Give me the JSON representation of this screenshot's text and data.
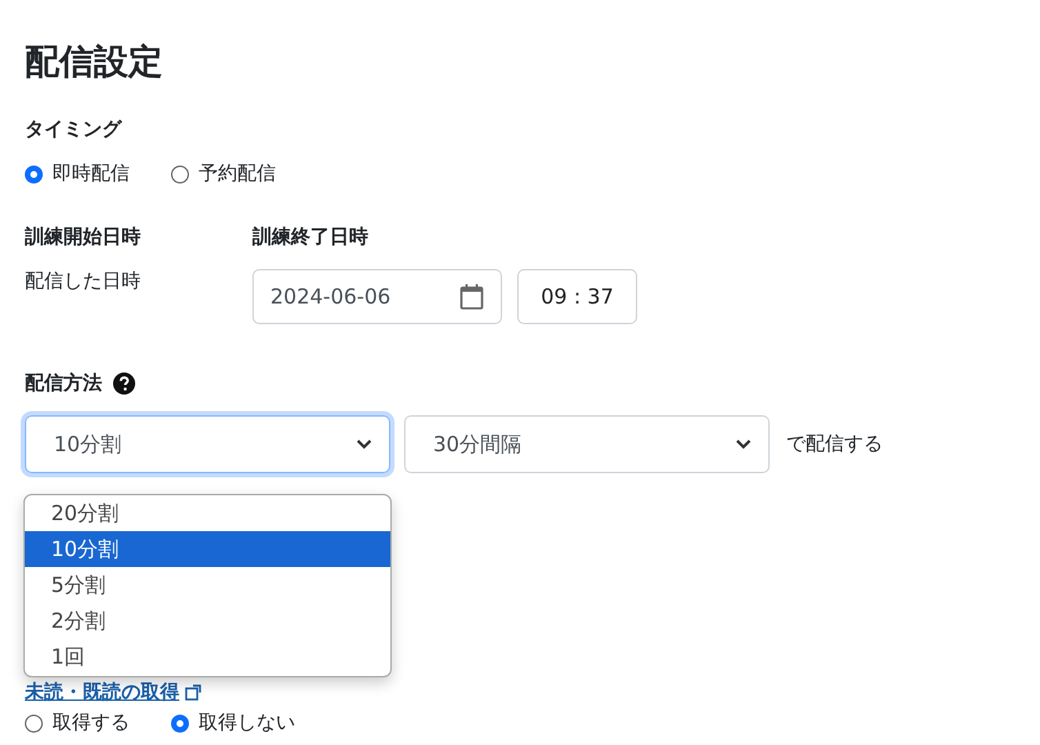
{
  "page_title": "配信設定",
  "timing": {
    "label": "タイミング",
    "options": [
      {
        "label": "即時配信",
        "selected": true
      },
      {
        "label": "予約配信",
        "selected": false
      }
    ]
  },
  "schedule": {
    "start": {
      "label": "訓練開始日時",
      "value": "配信した日時"
    },
    "end": {
      "label": "訓練終了日時",
      "date": "2024-06-06",
      "time": "09 : 37"
    }
  },
  "method": {
    "label": "配信方法",
    "split_select": {
      "value": "10分割",
      "open": true,
      "options": [
        {
          "label": "20分割",
          "selected": false
        },
        {
          "label": "10分割",
          "selected": true
        },
        {
          "label": "5分割",
          "selected": false
        },
        {
          "label": "2分割",
          "selected": false
        },
        {
          "label": "1回",
          "selected": false
        }
      ]
    },
    "interval_select": {
      "value": "30分間隔"
    },
    "suffix": "で配信する"
  },
  "read_tracking": {
    "label": "未読・既読の取得",
    "options": [
      {
        "label": "取得する",
        "selected": false
      },
      {
        "label": "取得しない",
        "selected": true
      }
    ]
  }
}
